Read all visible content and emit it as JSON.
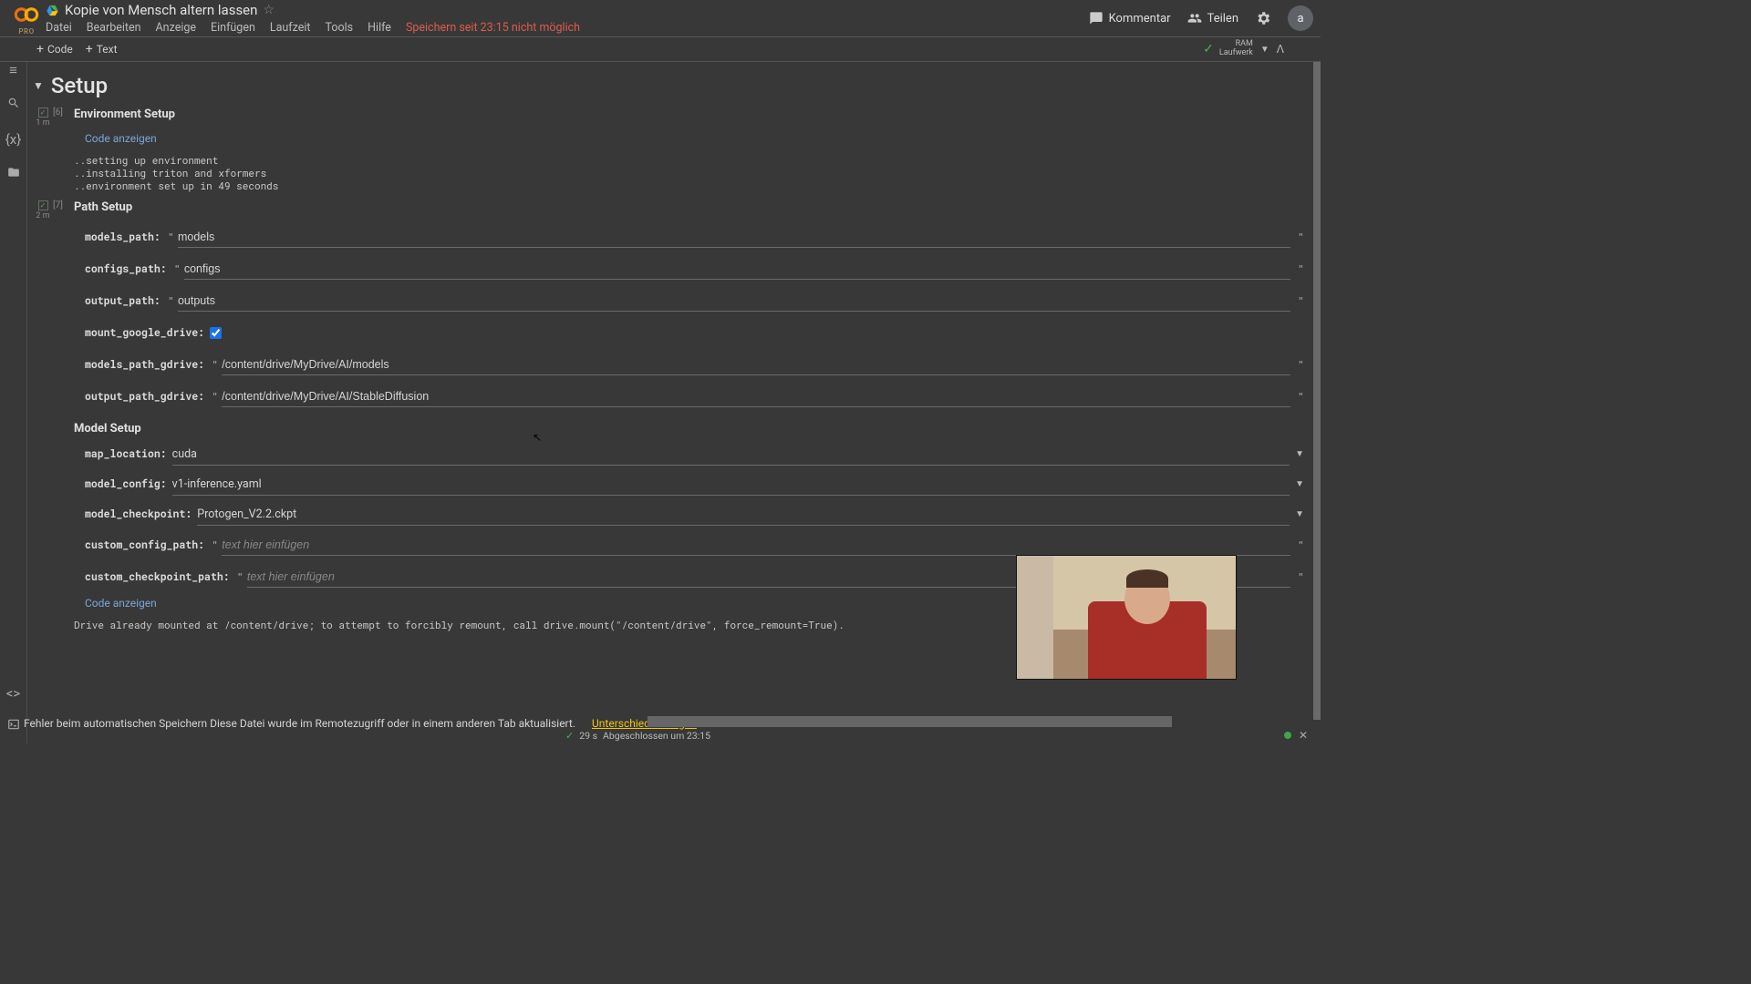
{
  "brand": {
    "pro": "PRO"
  },
  "notebook": {
    "title": "Kopie von Mensch altern lassen"
  },
  "menu": {
    "file": "Datei",
    "edit": "Bearbeiten",
    "view": "Anzeige",
    "insert": "Einfügen",
    "runtime": "Laufzeit",
    "tools": "Tools",
    "help": "Hilfe",
    "autosave_error": "Speichern seit 23:15 nicht möglich"
  },
  "header": {
    "comment": "Kommentar",
    "share": "Teilen",
    "avatar_letter": "a"
  },
  "toolbar": {
    "code": "Code",
    "text": "Text",
    "ram": "RAM",
    "disk": "Laufwerk"
  },
  "section": {
    "title": "Setup"
  },
  "cell1": {
    "run_time": "1 m",
    "exec": "[6]",
    "heading": "Environment Setup",
    "show_code": "Code anzeigen",
    "out1": "..setting up environment",
    "out2": "..installing triton and xformers",
    "out3": "..environment set up in 49 seconds"
  },
  "cell2": {
    "run_time": "2 m",
    "exec": "[7]",
    "heading": "Path Setup",
    "labels": {
      "models_path": "models_path:",
      "configs_path": "configs_path:",
      "output_path": "output_path:",
      "mount_google_drive": "mount_google_drive:",
      "models_path_gdrive": "models_path_gdrive:",
      "output_path_gdrive": "output_path_gdrive:",
      "map_location": "map_location:",
      "model_config": "model_config:",
      "model_checkpoint": "model_checkpoint:",
      "custom_config_path": "custom_config_path:",
      "custom_checkpoint_path": "custom_checkpoint_path:"
    },
    "values": {
      "models_path": "models",
      "configs_path": "configs",
      "output_path": "outputs",
      "models_path_gdrive": "/content/drive/MyDrive/AI/models",
      "output_path_gdrive": "/content/drive/MyDrive/AI/StableDiffusion",
      "map_location": "cuda",
      "model_config": "v1-inference.yaml",
      "model_checkpoint": "Protogen_V2.2.ckpt"
    },
    "placeholder": "text hier einfügen",
    "model_setup_head": "Model Setup",
    "show_code": "Code anzeigen",
    "output": "Drive already mounted at /content/drive; to attempt to forcibly remount, call drive.mount(\"/content/drive\", force_remount=True)."
  },
  "errorbar": {
    "msg": "Fehler beim automatischen Speichern Diese Datei wurde im Remotezugriff oder in einem anderen Tab aktualisiert.",
    "link": "Unterschied anzeigen"
  },
  "status": {
    "time": "29 s",
    "done": "Abgeschlossen um 23:15"
  }
}
